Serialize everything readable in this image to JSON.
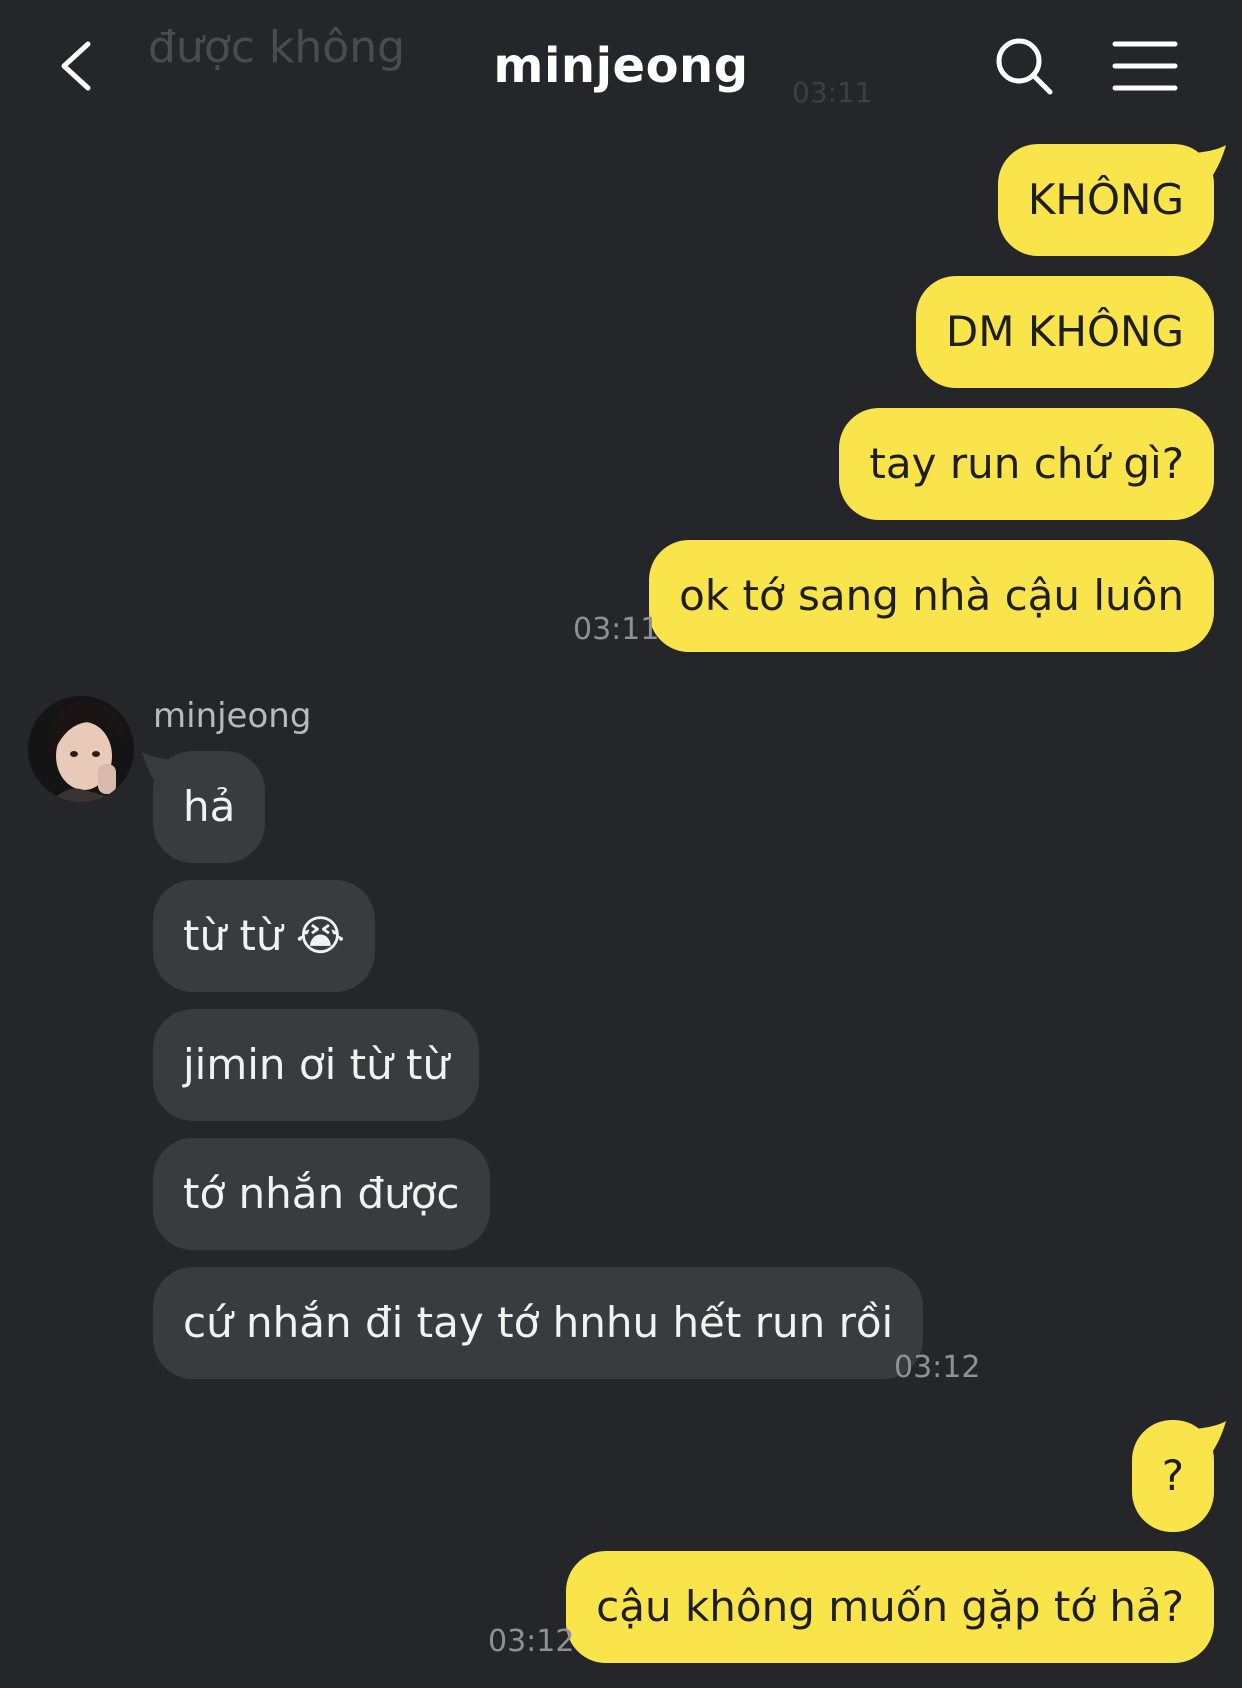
{
  "header": {
    "title": "minjeong",
    "icons": {
      "back": "chevron-left-icon",
      "search": "search-icon",
      "menu": "hamburger-menu-icon"
    }
  },
  "faded_previous": {
    "text": "được không",
    "time": "03:11"
  },
  "sent_group_1": {
    "messages": [
      "KHÔNG",
      "DM KHÔNG",
      "tay run chứ gì?",
      "ok tớ sang nhà cậu luôn"
    ],
    "time": "03:11"
  },
  "received_group": {
    "sender": "minjeong",
    "messages": [
      "hả",
      "từ từ 😭",
      "jimin ơi từ từ",
      "tớ nhắn được",
      "cứ nhắn đi tay tớ hnhu hết run rồi"
    ],
    "time": "03:12"
  },
  "sent_group_2": {
    "messages": [
      "?",
      "cậu không muốn gặp tớ hả?"
    ],
    "time": "03:12"
  },
  "colors": {
    "background": "#252629",
    "sent_bubble": "#f9e54b",
    "received_bubble": "#3a3b3f",
    "timestamp": "#8f9094"
  }
}
